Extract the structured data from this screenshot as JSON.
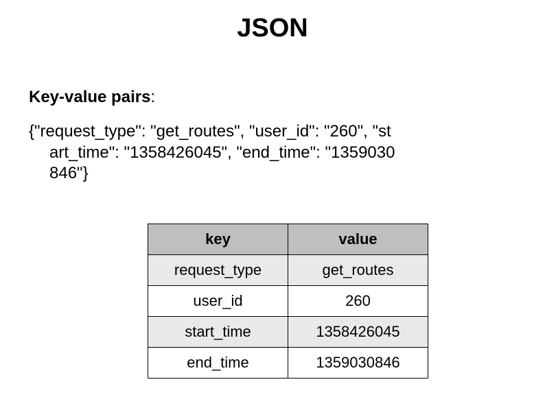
{
  "title": "JSON",
  "subhead": "Key-value pairs",
  "colon": ":",
  "json_lines": {
    "l1": "{\"request_type\": \"get_routes\", \"user_id\": \"260\", \"st",
    "l2": "art_time\": \"1358426045\", \"end_time\": \"1359030",
    "l3": "846\"}"
  },
  "table": {
    "header": {
      "key": "key",
      "value": "value"
    },
    "rows": [
      {
        "key": "request_type",
        "value": "get_routes"
      },
      {
        "key": "user_id",
        "value": "260"
      },
      {
        "key": "start_time",
        "value": "1358426045"
      },
      {
        "key": "end_time",
        "value": "1359030846"
      }
    ]
  }
}
